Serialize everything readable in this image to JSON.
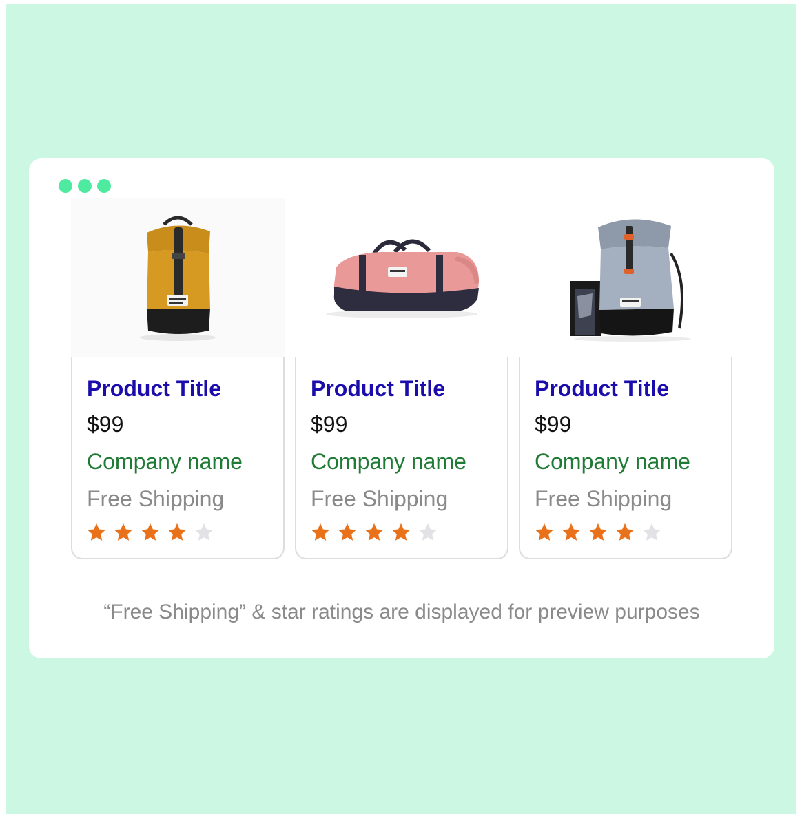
{
  "window": {
    "controls": [
      "dot",
      "dot",
      "dot"
    ]
  },
  "products": [
    {
      "title": "Product Title",
      "price": "$99",
      "company": "Company name",
      "shipping": "Free Shipping",
      "rating": 4,
      "max_rating": 5,
      "image": "yellow-backpack"
    },
    {
      "title": "Product Title",
      "price": "$99",
      "company": "Company name",
      "shipping": "Free Shipping",
      "rating": 4,
      "max_rating": 5,
      "image": "pink-duffel-bag"
    },
    {
      "title": "Product Title",
      "price": "$99",
      "company": "Company name",
      "shipping": "Free Shipping",
      "rating": 4,
      "max_rating": 5,
      "image": "grey-backpack-with-award"
    }
  ],
  "note": "“Free Shipping” & star ratings are displayed for preview purposes",
  "colors": {
    "background": "#ccf7e3",
    "dots": "#4eea9f",
    "title": "#1a0dab",
    "company": "#1e7a35",
    "muted": "#8a8a8a",
    "star_filled": "#e8711a",
    "star_empty": "#e2e2e6"
  }
}
